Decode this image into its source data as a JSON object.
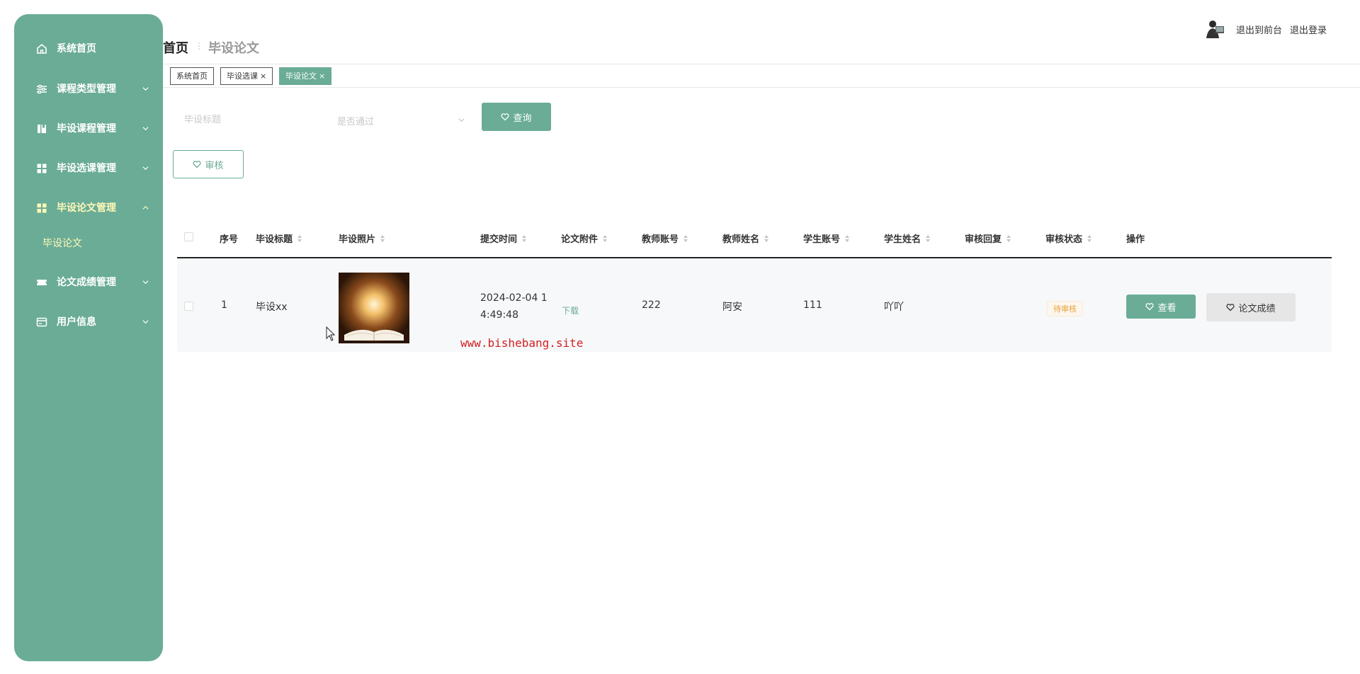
{
  "colors": {
    "accent": "#6aac96",
    "sidebar_bg": "#6aac96",
    "submenu_active": "#fff8b8",
    "pending": "#e6a23c",
    "watermark": "#d42020"
  },
  "sidebar": {
    "items": [
      {
        "label": "系统首页",
        "icon": "home-icon",
        "expandable": false
      },
      {
        "label": "课程类型管理",
        "icon": "sliders-icon",
        "expandable": true
      },
      {
        "label": "毕设课程管理",
        "icon": "book-icon",
        "expandable": true
      },
      {
        "label": "毕设选课管理",
        "icon": "grid-icon",
        "expandable": true
      },
      {
        "label": "毕设论文管理",
        "icon": "grid-icon",
        "expandable": true,
        "expanded": true
      },
      {
        "label": "论文成绩管理",
        "icon": "ticket-icon",
        "expandable": true
      },
      {
        "label": "用户信息",
        "icon": "card-icon",
        "expandable": true
      }
    ],
    "submenu": {
      "label": "毕设论文"
    }
  },
  "header": {
    "breadcrumb_home": "首页",
    "breadcrumb_current": "毕设论文",
    "exit_front": "退出到前台",
    "exit_login": "退出登录"
  },
  "tags": [
    {
      "label": "系统首页",
      "closable": false
    },
    {
      "label": "毕设选课",
      "closable": true
    },
    {
      "label": "毕设论文",
      "closable": true,
      "active": true
    }
  ],
  "search": {
    "title_placeholder": "毕设标题",
    "pass_placeholder": "是否通过",
    "query_label": "查询"
  },
  "actions": {
    "review_label": "审核"
  },
  "table": {
    "columns": [
      "序号",
      "毕设标题",
      "毕设照片",
      "提交时间",
      "论文附件",
      "教师账号",
      "教师姓名",
      "学生账号",
      "学生姓名",
      "审核回复",
      "审核状态",
      "操作"
    ],
    "rows": [
      {
        "index": "1",
        "title": "毕设xx",
        "submit_time_line1": "2024-02-04 1",
        "submit_time_line2": "4:49:48",
        "attachment": "下载",
        "teacher_account": "222",
        "teacher_name": "阿安",
        "student_account": "111",
        "student_name": "吖吖",
        "review_reply": "",
        "review_status": "待审核",
        "view_label": "查看",
        "grade_label": "论文成绩"
      }
    ]
  },
  "watermark": "www.bishebang.site"
}
